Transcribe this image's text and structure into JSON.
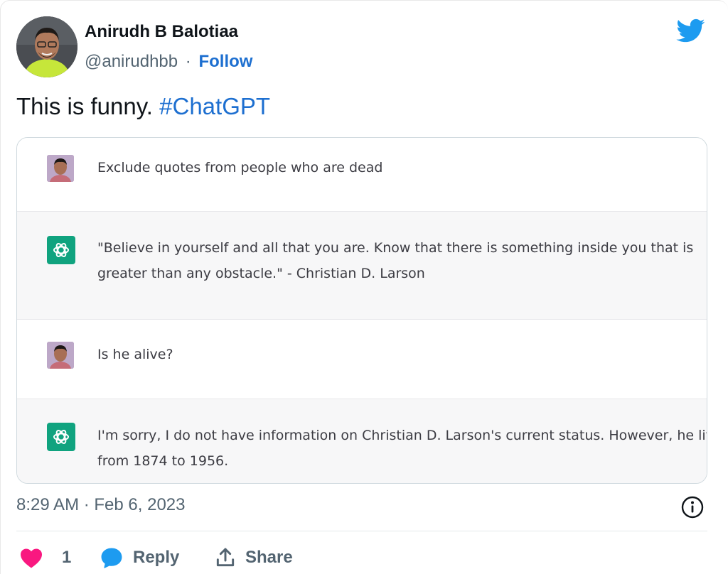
{
  "author": {
    "name": "Anirudh B Balotiaa",
    "handle": "@anirudhbb",
    "separator": "·",
    "follow_label": "Follow"
  },
  "tweet": {
    "text": "This is funny.",
    "hashtag": "#ChatGPT"
  },
  "conversation": [
    {
      "role": "user",
      "lines": [
        "Exclude quotes from people who are dead"
      ]
    },
    {
      "role": "assistant",
      "lines": [
        "\"Believe in yourself and all that you are. Know that there is something inside you that is",
        "greater than any obstacle.\" - Christian D. Larson"
      ]
    },
    {
      "role": "user",
      "lines": [
        "Is he alive?"
      ]
    },
    {
      "role": "assistant",
      "lines": [
        "I'm sorry, I do not have information on Christian D. Larson's current status. However, he lived",
        "from 1874 to 1956."
      ]
    }
  ],
  "footer": {
    "timestamp": "8:29 AM · Feb 6, 2023",
    "like_count": "1",
    "reply_label": "Reply",
    "share_label": "Share"
  },
  "colors": {
    "link": "#1d6fd0",
    "like": "#f91880",
    "twitter": "#1d9bf0",
    "chatgpt": "#10a37f"
  },
  "icons": [
    "twitter-logo-icon",
    "chatgpt-logo-icon",
    "info-icon",
    "heart-icon",
    "reply-bubble-icon",
    "share-icon"
  ]
}
